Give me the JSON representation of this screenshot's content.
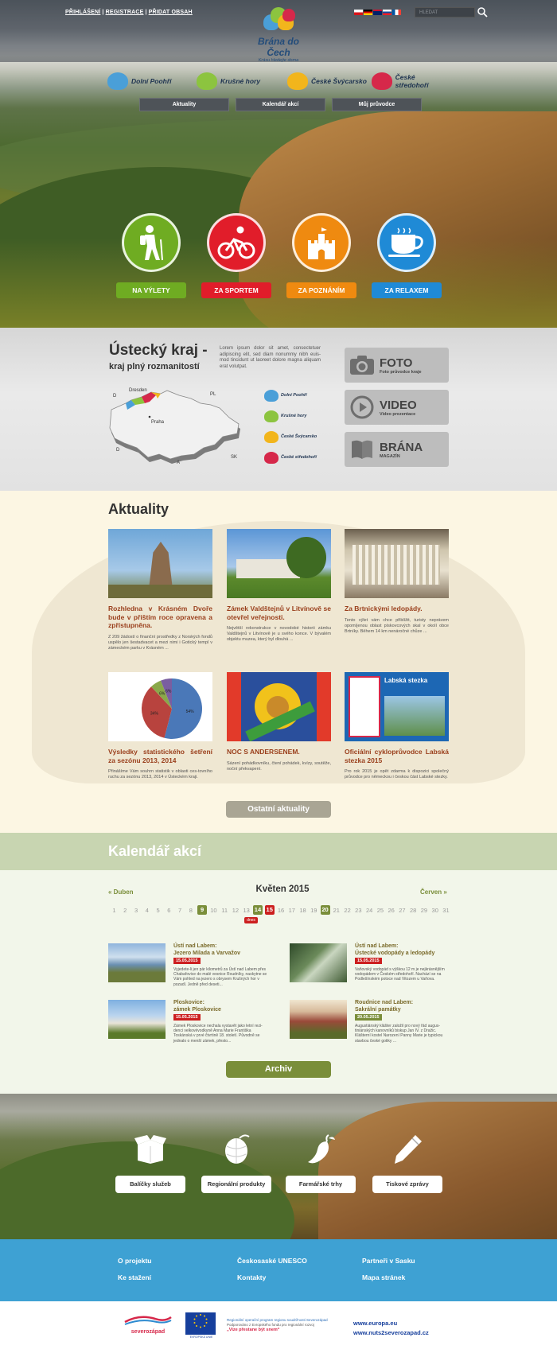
{
  "header": {
    "links": [
      "PŘIHLÁŠENÍ",
      "REGISTRACE",
      "PŘIDAT OBSAH"
    ],
    "logo_title": "Brána do Čech",
    "logo_subtitle": "Krásu hledejte doma",
    "search_placeholder": "HLEDAT",
    "flags": [
      {
        "name": "cz",
        "colors": [
          "#ffffff",
          "#d7141a",
          "#11457e"
        ]
      },
      {
        "name": "de",
        "colors": [
          "#000000",
          "#dd0000",
          "#ffce00"
        ]
      },
      {
        "name": "gb",
        "colors": [
          "#012169",
          "#c8102e",
          "#ffffff"
        ]
      },
      {
        "name": "sk",
        "colors": [
          "#ffffff",
          "#0b4ea2",
          "#ee1c25"
        ]
      },
      {
        "name": "fr",
        "colors": [
          "#0055a4",
          "#ffffff",
          "#ef4135"
        ]
      }
    ]
  },
  "regions": [
    {
      "label": "Dolní Poohří",
      "color": "#4a9fd8"
    },
    {
      "label": "Krušné hory",
      "color": "#8cc43f"
    },
    {
      "label": "České Švýcarsko",
      "color": "#f2b51c"
    },
    {
      "label": "České středohoří",
      "color": "#d6284a"
    }
  ],
  "nav": [
    "Aktuality",
    "Kalendář akcí",
    "Můj průvodce"
  ],
  "categories": [
    {
      "label": "NA VÝLETY",
      "color": "#6fac22",
      "icon": "hiker-icon"
    },
    {
      "label": "ZA SPORTEM",
      "color": "#e11d2a",
      "icon": "cyclist-icon"
    },
    {
      "label": "ZA POZNÁNÍM",
      "color": "#ef8a10",
      "icon": "castle-icon"
    },
    {
      "label": "ZA RELAXEM",
      "color": "#1f8ad6",
      "icon": "coffee-cup-icon"
    }
  ],
  "intro": {
    "title": "Ústecký kraj -",
    "subtitle": "kraj plný rozmanitostí",
    "text": "Lorem ipsum dolor sit amet, consectetuer adipiscing elit, sed diam nonummy nibh euis-mod tincidunt ut laoreet dolore magna aliquam erat volutpat.",
    "map_labels": [
      "Dresden",
      "PL",
      "D",
      "Praha",
      "D",
      "A",
      "SK"
    ],
    "legend": [
      "Dolní Poohří",
      "Krušné hory",
      "České Švýcarsko",
      "České středohoří"
    ]
  },
  "media": [
    {
      "title": "FOTO",
      "sub": "Foto průvodce kraje",
      "icon": "camera-icon"
    },
    {
      "title": "VIDEO",
      "sub": "Video prezentace",
      "icon": "play-icon"
    },
    {
      "title": "BRÁNA",
      "sub": "MAGAZÍN",
      "icon": "book-icon"
    }
  ],
  "news": {
    "heading": "Aktuality",
    "items": [
      {
        "title": "Rozhledna v Krásném Dvoře bude v příštím roce opravena a zpřístupněna.",
        "text": "Z 209 žádostí o finanční prostředky z Norských fondů uspělo jen šestadvacet a mezi nimi i Gotický templ v zámeckém parku v Krásném ..."
      },
      {
        "title": "Zámek Valdštejnů v Litvínově se otevřel veřejnosti.",
        "text": "Největší rekonstrukce v novodobé historii zámku Valdštejnů v Litvínově je u svého konce. V bývalém objektu muzea, který byl dlouhá ..."
      },
      {
        "title": "Za Brtnickými ledopády.",
        "text": "Tento výlet vám chce přiblížit, turisty neprávem opomíjenou oblast pískovcových skal v okolí obce Brtníky. Během 14 km nenáročné chůze ..."
      },
      {
        "title": "Výsledky statistického šetření za sezónu 2013, 2014",
        "text": "Přinášíme Vám souhrn statistik v oblasti ces-tovního ruchu za sezónu 2013, 2014 v Ústeckém kraji."
      },
      {
        "title": "NOC S ANDERSENEM.",
        "text": "Sázení pohádkovníku, čtení pohádek, kvízy, soutěže, noční překvapení."
      },
      {
        "title": "Oficiální cykloprůvodce Labská stezka 2015",
        "text": "Pro rok 2015 je opět zdarma k dispozici společný průvodce pro německou i českou část Labské stezky."
      }
    ],
    "pie": {
      "labels": [
        "54%",
        "34%",
        "6%",
        "6%"
      ],
      "values": [
        54,
        34,
        6,
        6
      ]
    },
    "brochure_title": "Labská stezka",
    "more": "Ostatní aktuality"
  },
  "calendar": {
    "heading": "Kalendář akcí",
    "prev": "« Duben",
    "month": "Květen 2015",
    "next": "Červen »",
    "days": [
      "1",
      "2",
      "3",
      "4",
      "5",
      "6",
      "7",
      "8",
      "9",
      "10",
      "11",
      "12",
      "13",
      "14",
      "15",
      "16",
      "17",
      "18",
      "19",
      "20",
      "21",
      "22",
      "23",
      "24",
      "25",
      "26",
      "27",
      "28",
      "29",
      "30",
      "31"
    ],
    "highlight": [
      "9",
      "14",
      "20"
    ],
    "today": "15",
    "today_label": "dnes",
    "events": [
      {
        "place": "Ústí nad Labem:",
        "name": "Jezero Milada a Varvažov",
        "date": "15.05.2015",
        "text": "Vyjedete-li jen pár kilometrů za Ústí nad Labem přes Chabařovice do malé vesnice Roudníky, naskytne se Vám pohled na jezero s obrysem Krušných hor v pozadí. Jedně před deseti..."
      },
      {
        "place": "Ústí nad Labem:",
        "name": "Ústecké vodopády a ledopády",
        "date": "15.05.2015",
        "text": "Vaňovský vodopád s výškou 12 m je nejkrásnějším vodopádem v Českém středohoří. Nachází se na Podlešínském potoce nad Vitozem u Vaňova."
      },
      {
        "place": "Ploskovice:",
        "name": "zámek Ploskovice",
        "date": "15.05.2015",
        "text": "Zámek Ploskovice nechala vystavět jako letní rezi-denci velkovévodkyně Anna Marie Františka Toskánská v prvé čtvrtině 18. století. Původně se jednalo o menší zámek, přesto..."
      },
      {
        "place": "Roudnice nad Labem:",
        "name": "Sakrální památky",
        "date": "20.05.2015",
        "text": "Augustiánský klášter založil pro nový řád augus-tiniánských kanovníků biskup Jan IV. z Dražic. Klášterní kostel Narození Panny Marie je typickou stavbou české gotiky ..."
      }
    ],
    "archive": "Archiv"
  },
  "services": [
    {
      "label": "Balíčky služeb",
      "icon": "package-icon"
    },
    {
      "label": "Regionální produkty",
      "icon": "hops-icon"
    },
    {
      "label": "Farmářské trhy",
      "icon": "pepper-icon"
    },
    {
      "label": "Tiskové zprávy",
      "icon": "pen-icon"
    }
  ],
  "footer": {
    "links": [
      "O projektu",
      "Ke stažení",
      "Českosaské UNESCO",
      "Kontakty",
      "Partneři v Sasku",
      "Mapa stránek"
    ],
    "partner_logo": "severozápad",
    "eu_label": "EVROPSKÁ UNIE",
    "program_text": [
      "Regionální operační program regionu soudržnosti Severozápad",
      "Podporováno z Evropského fondu pro regionální rozvoj",
      "„Vize přestane být snem“"
    ],
    "urls": [
      "www.europa.eu",
      "www.nuts2severozapad.cz"
    ]
  }
}
